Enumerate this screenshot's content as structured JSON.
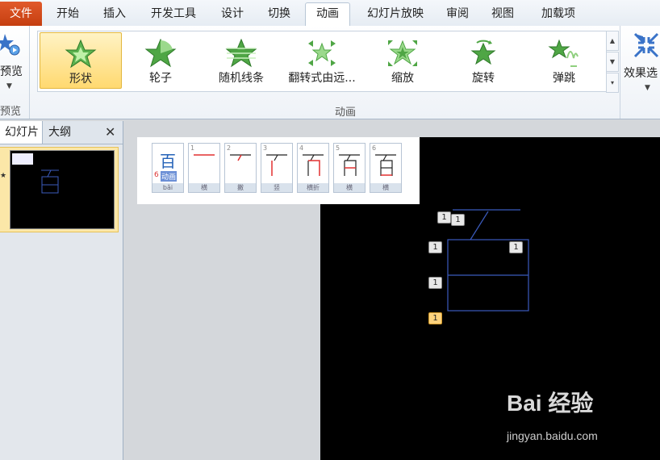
{
  "tabs": {
    "file": "文件",
    "items": [
      "开始",
      "插入",
      "开发工具",
      "设计",
      "切换",
      "动画",
      "幻灯片放映",
      "审阅",
      "视图",
      "加载项"
    ],
    "active": "动画"
  },
  "ribbon": {
    "preview_label": "预览",
    "preview_group_label": "预览",
    "gallery": [
      {
        "label": "形状",
        "icon": "star-shape-icon",
        "selected": true
      },
      {
        "label": "轮子",
        "icon": "star-wheel-icon"
      },
      {
        "label": "随机线条",
        "icon": "star-lines-icon"
      },
      {
        "label": "翻转式由远...",
        "icon": "star-flip-icon"
      },
      {
        "label": "缩放",
        "icon": "star-zoom-icon"
      },
      {
        "label": "旋转",
        "icon": "star-spin-icon"
      },
      {
        "label": "弹跳",
        "icon": "star-bounce-icon"
      }
    ],
    "animation_group_label": "动画",
    "effect_options_label": "效果选"
  },
  "left_pane": {
    "tab_slides": "幻灯片",
    "tab_outline": "大纲",
    "close": "✕"
  },
  "strip": {
    "main_char": "百",
    "main_num": "6",
    "main_tag": "动画",
    "main_caption": "bǎi",
    "strokes": [
      {
        "idx": "1",
        "caption": "横"
      },
      {
        "idx": "2",
        "caption": "撇"
      },
      {
        "idx": "3",
        "caption": "竖"
      },
      {
        "idx": "4",
        "caption": "横折"
      },
      {
        "idx": "5",
        "caption": "横"
      },
      {
        "idx": "6",
        "caption": "横"
      }
    ]
  },
  "slide": {
    "tags": [
      "1",
      "1",
      "1",
      "1",
      "1",
      "1"
    ],
    "accent": "#3b5bbd"
  },
  "watermark": {
    "brand": "Bai 经验",
    "url": "jingyan.baidu.com"
  }
}
